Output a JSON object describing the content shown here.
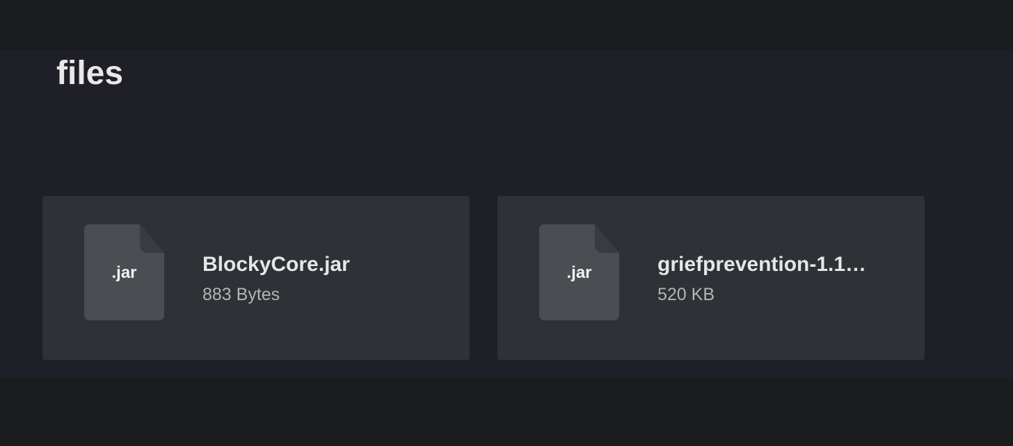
{
  "page": {
    "title": "files"
  },
  "files": [
    {
      "extension": ".jar",
      "name": "BlockyCore.jar",
      "size": "883 Bytes",
      "icon": "file-icon"
    },
    {
      "extension": ".jar",
      "name": "griefprevention-1.1…",
      "size": "520 KB",
      "icon": "file-icon"
    }
  ],
  "colors": {
    "page_background": "#1b1c1e",
    "panel_background": "#1e1f27",
    "card_background": "#2e3135",
    "icon_fill": "#4a4e53",
    "icon_fold": "#383b40",
    "title_text": "#e8e8e8",
    "size_text": "#b4b4b4"
  }
}
